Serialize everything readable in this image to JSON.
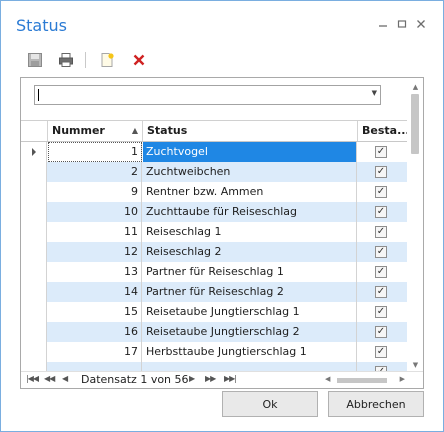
{
  "window": {
    "title": "Status"
  },
  "toolbar": {
    "icons": [
      "save-icon",
      "print-icon",
      "new-document-icon",
      "delete-icon"
    ],
    "accent_color": "#cf2222"
  },
  "combo": {
    "value": ""
  },
  "table": {
    "columns": [
      "Nummer",
      "Status",
      "Besta..."
    ],
    "sort": {
      "column": "Nummer",
      "direction": "ascending"
    },
    "rows": [
      {
        "nummer": "1",
        "status": "Zuchtvogel",
        "checked": true,
        "selected": true
      },
      {
        "nummer": "2",
        "status": "Zuchtweibchen",
        "checked": true
      },
      {
        "nummer": "9",
        "status": "Rentner bzw. Ammen",
        "checked": true
      },
      {
        "nummer": "10",
        "status": "Zuchttaube für Reiseschlag",
        "checked": true
      },
      {
        "nummer": "11",
        "status": "Reiseschlag  1",
        "checked": true
      },
      {
        "nummer": "12",
        "status": "Reiseschlag 2",
        "checked": true
      },
      {
        "nummer": "13",
        "status": "Partner für Reiseschlag 1",
        "checked": true
      },
      {
        "nummer": "14",
        "status": "Partner für Reiseschlag 2",
        "checked": true
      },
      {
        "nummer": "15",
        "status": "Reisetaube Jungtierschlag 1",
        "checked": true
      },
      {
        "nummer": "16",
        "status": "Reisetaube Jungtierschlag 2",
        "checked": true
      },
      {
        "nummer": "17",
        "status": "Herbsttaube Jungtierschlag 1",
        "checked": true
      },
      {
        "nummer": "",
        "status": "",
        "checked": true
      }
    ]
  },
  "navigator": {
    "record_text": "Datensatz 1 von 56"
  },
  "buttons": {
    "ok": "Ok",
    "cancel": "Abbrechen"
  },
  "colors": {
    "title": "#2b7bd4",
    "selection": "#1f87e4",
    "alt_row": "#dcebfa"
  }
}
